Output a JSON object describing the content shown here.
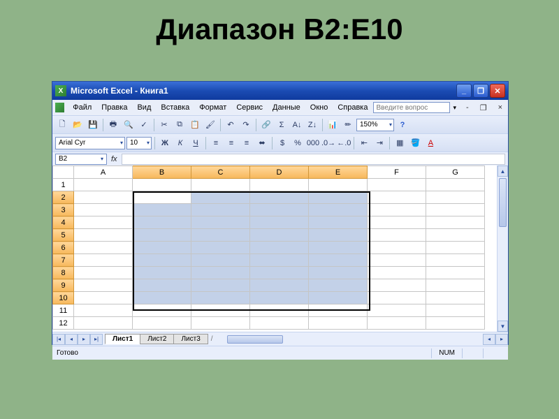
{
  "slide": {
    "title": "Диапазон В2:Е10"
  },
  "window": {
    "title": "Microsoft Excel - Книга1",
    "min": "_",
    "max": "❐",
    "close": "✕"
  },
  "menu": {
    "items": [
      "Файл",
      "Правка",
      "Вид",
      "Вставка",
      "Формат",
      "Сервис",
      "Данные",
      "Окно",
      "Справка"
    ],
    "ask_placeholder": "Введите вопрос",
    "mdi_close": "×"
  },
  "toolbar1": {
    "zoom": "150%"
  },
  "toolbar2": {
    "font": "Arial Cyr",
    "size": "10",
    "bold": "Ж",
    "italic": "К",
    "underline": "Ч"
  },
  "namebox": "B2",
  "fx": "fx",
  "columns": [
    "A",
    "B",
    "C",
    "D",
    "E",
    "F",
    "G"
  ],
  "rows": [
    "1",
    "2",
    "3",
    "4",
    "5",
    "6",
    "7",
    "8",
    "9",
    "10",
    "11",
    "12"
  ],
  "selection": {
    "col_start": 1,
    "col_end": 4,
    "row_start": 1,
    "row_end": 9,
    "active_ref": "B2"
  },
  "sheets": {
    "nav": [
      "|◂",
      "◂",
      "▸",
      "▸|"
    ],
    "tabs": [
      "Лист1",
      "Лист2",
      "Лист3"
    ],
    "active": 0,
    "tail": "/"
  },
  "status": {
    "ready": "Готово",
    "num": "NUM"
  }
}
